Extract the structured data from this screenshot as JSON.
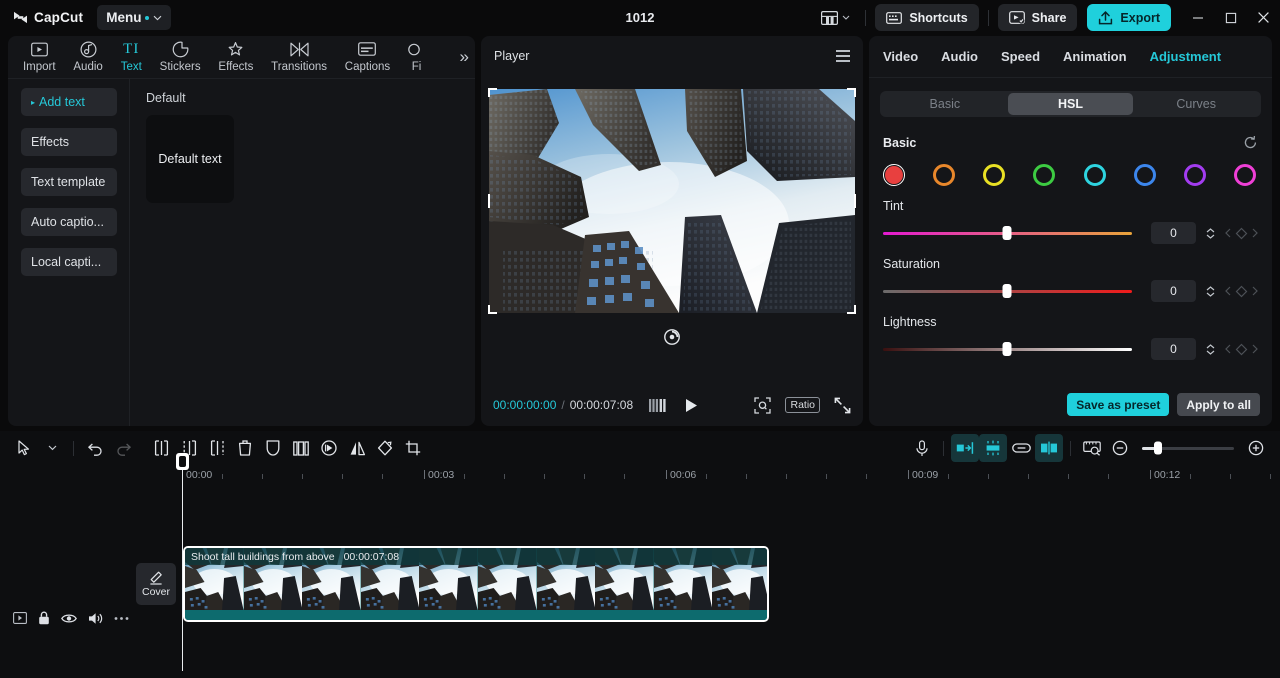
{
  "app": {
    "brand": "CapCut",
    "menu_label": "Menu",
    "project_title": "1012",
    "shortcuts_label": "Shortcuts",
    "share_label": "Share",
    "export_label": "Export",
    "accent": "#25c8d8",
    "export_bg": "#1fd0dc"
  },
  "window_controls": {
    "minimize": "–",
    "maximize": "□",
    "close": "✕"
  },
  "left_panel": {
    "tabs": [
      {
        "label": "Import",
        "icon": "import-icon",
        "active": false
      },
      {
        "label": "Audio",
        "icon": "audio-icon",
        "active": false
      },
      {
        "label": "Text",
        "icon": "text-icon",
        "active": true
      },
      {
        "label": "Stickers",
        "icon": "stickers-icon",
        "active": false
      },
      {
        "label": "Effects",
        "icon": "effects-icon",
        "active": false
      },
      {
        "label": "Transitions",
        "icon": "transitions-icon",
        "active": false
      },
      {
        "label": "Captions",
        "icon": "captions-icon",
        "active": false
      },
      {
        "label": "Fi",
        "icon": "filters-icon",
        "active": false
      }
    ],
    "more_label": "»",
    "side_items": [
      {
        "label": "Add text",
        "active": true
      },
      {
        "label": "Effects",
        "active": false
      },
      {
        "label": "Text template",
        "active": false
      },
      {
        "label": "Auto captio...",
        "active": false
      },
      {
        "label": "Local capti...",
        "active": false
      }
    ],
    "section_title": "Default",
    "default_card_label": "Default text"
  },
  "player": {
    "title": "Player",
    "current_time": "00:00:00:00",
    "time_separator": "/",
    "total_time": "00:00:07:08",
    "ratio_label": "Ratio"
  },
  "right_panel": {
    "tabs": [
      {
        "label": "Video",
        "active": false
      },
      {
        "label": "Audio",
        "active": false
      },
      {
        "label": "Speed",
        "active": false
      },
      {
        "label": "Animation",
        "active": false
      },
      {
        "label": "Adjustment",
        "active": true
      }
    ],
    "segments": [
      {
        "label": "Basic",
        "active": false
      },
      {
        "label": "HSL",
        "active": true
      },
      {
        "label": "Curves",
        "active": false
      }
    ],
    "section_label": "Basic",
    "swatches": [
      {
        "name": "red",
        "color": "#e8403f",
        "selected": true
      },
      {
        "name": "orange",
        "color": "#e8872b",
        "selected": false
      },
      {
        "name": "yellow",
        "color": "#e8e024",
        "selected": false
      },
      {
        "name": "green",
        "color": "#3dcb42",
        "selected": false
      },
      {
        "name": "cyan",
        "color": "#2ed4e0",
        "selected": false
      },
      {
        "name": "blue",
        "color": "#3c86ec",
        "selected": false
      },
      {
        "name": "purple",
        "color": "#a33cf0",
        "selected": false
      },
      {
        "name": "magenta",
        "color": "#ef3fd6",
        "selected": false
      }
    ],
    "sliders": [
      {
        "label": "Tint",
        "value": "0",
        "position": 50,
        "grad_from": "#e41ad1",
        "grad_to": "#e8a33a"
      },
      {
        "label": "Saturation",
        "value": "0",
        "position": 50,
        "grad_from": "#6b6b6b",
        "grad_to": "#f01b1b"
      },
      {
        "label": "Lightness",
        "value": "0",
        "position": 50,
        "grad_from": "#3a1010",
        "grad_to": "#ffffff"
      }
    ],
    "save_preset_label": "Save as preset",
    "apply_all_label": "Apply to all"
  },
  "timeline": {
    "left_tools": [
      {
        "name": "select-tool",
        "state": "normal"
      },
      {
        "name": "select-dropdown",
        "state": "normal"
      },
      {
        "name": "undo",
        "state": "normal"
      },
      {
        "name": "redo",
        "state": "disabled"
      },
      {
        "name": "split",
        "state": "normal"
      },
      {
        "name": "trim-left",
        "state": "normal"
      },
      {
        "name": "trim-right",
        "state": "normal"
      },
      {
        "name": "delete",
        "state": "normal"
      },
      {
        "name": "mask",
        "state": "normal"
      },
      {
        "name": "freeze-frame",
        "state": "normal"
      },
      {
        "name": "reverse",
        "state": "normal"
      },
      {
        "name": "mirror",
        "state": "normal"
      },
      {
        "name": "rotate",
        "state": "normal"
      },
      {
        "name": "crop",
        "state": "normal"
      }
    ],
    "right_tools": [
      {
        "name": "record-voiceover",
        "state": "normal"
      },
      {
        "name": "snap-to-clip",
        "state": "active"
      },
      {
        "name": "auto-fit",
        "state": "active"
      },
      {
        "name": "link-clips",
        "state": "normal"
      },
      {
        "name": "split-align",
        "state": "active"
      },
      {
        "name": "preview-scroll",
        "state": "normal"
      },
      {
        "name": "zoom-out",
        "state": "normal"
      },
      {
        "name": "zoom-in",
        "state": "normal"
      }
    ],
    "ruler_labels": [
      "00:00",
      "00:03",
      "00:06",
      "00:09",
      "00:12"
    ],
    "track_header_icons": [
      "video-track-icon",
      "lock-icon",
      "eye-icon",
      "volume-icon",
      "more-icon"
    ],
    "cover_label": "Cover",
    "clip": {
      "name": "Shoot tall buildings from above",
      "duration": "00:00:07:08"
    }
  }
}
